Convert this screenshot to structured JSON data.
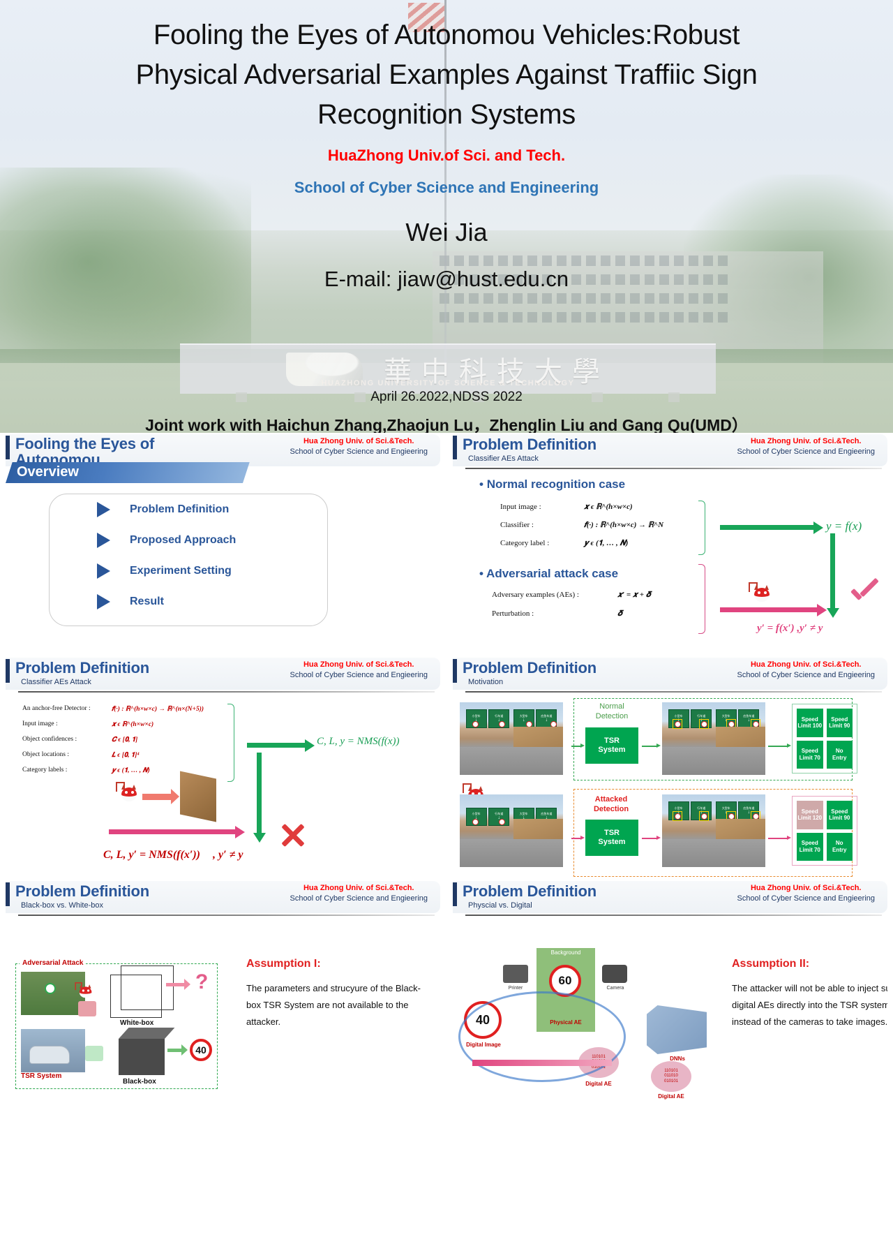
{
  "title_slide": {
    "title_lines": [
      "Fooling  the Eyes of Autonomou Vehicles:Robust",
      "Physical Adversarial Examples Against Traffiic Sign",
      "Recognition Systems"
    ],
    "university": "HuaZhong Univ.of Sci. and Tech.",
    "school": "School of Cyber Science and Engineering",
    "author": "Wei Jia",
    "email": "E-mail: jiaw@hust.edu.cn",
    "date_venue": "April 26.2022,NDSS 2022",
    "joint_work": "Joint work with Haichun Zhang,Zhaojun Lu，Zhenglin Liu and Gang Qu(UMD）",
    "sign_cn": "華中科技大學",
    "sign_en": "HUAZHONG UNIVERSITY OF SCIENCE & TECHNOLOGY",
    "colors": {
      "red": "#ff0000",
      "blue": "#2e74b5"
    }
  },
  "common": {
    "org_line1": "Hua Zhong Univ. of Sci.&Tech.",
    "org_line2": "School of Cyber Science and Engieering"
  },
  "slide_overview": {
    "header_title": "Fooling  the Eyes of Autonomou",
    "banner": "Overview",
    "items": [
      {
        "label": "Problem Definition"
      },
      {
        "label": "Proposed Approach"
      },
      {
        "label": "Experiment Setting"
      },
      {
        "label": "Result"
      }
    ]
  },
  "slide_classifier": {
    "header_title": "Problem Definition",
    "subtitle": "Classifier AEs Attack",
    "normal_case": {
      "heading": "Normal recognition case",
      "rows": [
        {
          "label": "Input image :",
          "value": "𝒙 ϵ ℝ^(h×w×c)"
        },
        {
          "label": "Classifier :",
          "value": "𝒇(·) : ℝ^(h×w×c) → ℝ^N"
        },
        {
          "label": "Category label :",
          "value": "𝒚 ϵ (𝟏, … , 𝑵)"
        }
      ],
      "result": "y =  f(x)"
    },
    "adversarial_case": {
      "heading": "Adversarial attack case",
      "rows": [
        {
          "label": "Adversary examples (AEs) :",
          "value": "𝒙′ = 𝒙 + 𝜹"
        },
        {
          "label": "Perturbation :",
          "value": "𝜹"
        }
      ],
      "result": "y′ = f(x′)  ,y′ ≠ y"
    }
  },
  "slide_detector": {
    "header_title": "Problem Definition",
    "subtitle": "Classifier AEs Attack",
    "rows": [
      {
        "label": "An anchor-free Detector :",
        "value": "𝒇(·) : ℝ^(h×w×c) → ℝ^(n×(N+5))"
      },
      {
        "label": "Input image :",
        "value": "𝒙 ϵ ℝ^(h×w×c)"
      },
      {
        "label": "Object confidences :",
        "value": "𝑪 ϵ [𝟎, 𝟏]"
      },
      {
        "label": "Object locations :",
        "value": "𝑳 ϵ [𝟎, 𝟏]⁴"
      },
      {
        "label": "Category labels :",
        "value": "𝒚 ϵ (𝟏, … , 𝑵)"
      }
    ],
    "eq_normal": "C, L, y = NMS(f(x))",
    "eq_attack": "C, L, y′ = NMS(f(x′))",
    "eq_attack_suffix": ", y′ ≠ y"
  },
  "slide_motivation": {
    "header_title": "Problem Definition",
    "subtitle": "Motivation",
    "normal_label": "Normal\nDetection",
    "attacked_label": "Attacked\nDetection",
    "tsr_box": "TSR\nSystem",
    "normal_chips": [
      {
        "line1": "Speed",
        "line2": "Limit 100",
        "muted": false
      },
      {
        "line1": "Speed",
        "line2": "Limit 90",
        "muted": false
      },
      {
        "line1": "Speed",
        "line2": "Limit 70",
        "muted": false
      },
      {
        "line1": "No",
        "line2": "Entry",
        "muted": false
      }
    ],
    "attacked_chips": [
      {
        "line1": "Speed",
        "line2": "Limit 120",
        "muted": true
      },
      {
        "line1": "Speed",
        "line2": "Limit 90",
        "muted": false
      },
      {
        "line1": "Speed",
        "line2": "Limit 70",
        "muted": false
      },
      {
        "line1": "No",
        "line2": "Entry",
        "muted": false
      }
    ],
    "sign_cn_labels": [
      "小型车",
      "行车道",
      "大型车",
      "应急车道"
    ]
  },
  "slide_blackbox": {
    "header_title": "Problem Definition",
    "subtitle": "Black-box vs. White-box",
    "diagram": {
      "adv_attack_label": "Adversarial Attack",
      "whitebox_label": "White-box",
      "blackbox_label": "Black-box",
      "tsr_label": "TSR System",
      "question": "?",
      "speed_value": "40"
    },
    "assumption_title": "Assumption I:",
    "assumption_body": "The parameters and strucyure of the Black-box TSR System are not available to the attacker."
  },
  "slide_physical": {
    "header_title": "Problem Definition",
    "subtitle": "Physcial vs. Digital",
    "diagram": {
      "digital_image": "Digital Image",
      "physical_ae": "Physical AE",
      "digital_ae": "Digital AE",
      "background": "Background",
      "printer": "Printer",
      "camera": "Camera",
      "dnns": "DNNs",
      "sign_value_1": "40",
      "sign_value_2": "60",
      "bits": "110101\n011010\n010101"
    },
    "assumption_title": "Assumption II:",
    "assumption_body": "The attacker will not be able to inject such digital AEs directly into the TSR  system  instead of the cameras to take images."
  }
}
